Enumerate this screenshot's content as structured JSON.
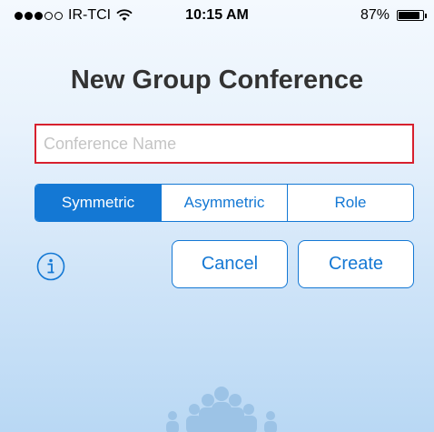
{
  "status_bar": {
    "carrier": "IR-TCI",
    "time": "10:15 AM",
    "battery_percent": "87%",
    "battery_level": 0.87,
    "signal_bars_filled": 3,
    "signal_bars_total": 5
  },
  "page": {
    "title": "New Group Conference"
  },
  "conference_name": {
    "value": "",
    "placeholder": "Conference Name"
  },
  "conference_types": {
    "options": [
      "Symmetric",
      "Asymmetric",
      "Role"
    ],
    "selected": "Symmetric"
  },
  "actions": {
    "cancel_label": "Cancel",
    "create_label": "Create"
  },
  "icons": {
    "info": "info-icon",
    "wifi": "wifi-icon",
    "battery": "battery-icon",
    "illustration": "people-group-icon"
  },
  "colors": {
    "accent": "#1478d4",
    "input_border_error": "#d7202e",
    "title": "#333333",
    "illustration": "#9cc3e6"
  }
}
